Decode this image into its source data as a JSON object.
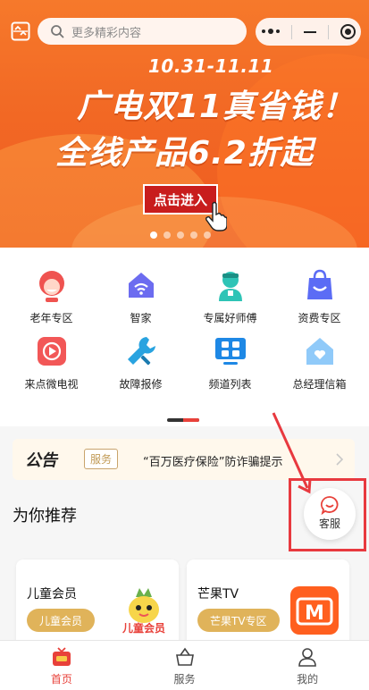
{
  "header": {
    "search_placeholder": "更多精彩内容"
  },
  "banner": {
    "date_range": "10.31-11.11",
    "headline_1": "广电双11真省钱！",
    "headline_2": "全线产品6.2折起",
    "enter_button": "点击进入",
    "slide_count": 5,
    "active_slide": 1
  },
  "services": [
    {
      "label": "老年专区",
      "icon": "elder-icon"
    },
    {
      "label": "智家",
      "icon": "smart-home-icon"
    },
    {
      "label": "专属好师傅",
      "icon": "technician-icon"
    },
    {
      "label": "资费专区",
      "icon": "tariff-bag-icon"
    },
    {
      "label": "来点微电视",
      "icon": "micro-tv-icon"
    },
    {
      "label": "故障报修",
      "icon": "repair-wrench-icon"
    },
    {
      "label": "频道列表",
      "icon": "channel-list-icon"
    },
    {
      "label": "总经理信箱",
      "icon": "manager-mailbox-icon"
    }
  ],
  "notice": {
    "title": "公告",
    "tag": "服务",
    "text": "“百万医疗保险”防诈骗提示"
  },
  "recommend": {
    "title": "为你推荐",
    "cards": [
      {
        "title": "儿童会员",
        "button": "儿童会员",
        "image_text": "儿童会员"
      },
      {
        "title": "芒果TV",
        "button": "芒果TV专区",
        "image_text": "M"
      }
    ]
  },
  "customer_service": {
    "label": "客服"
  },
  "tabbar": {
    "items": [
      {
        "label": "首页",
        "icon": "tv-home-icon",
        "active": true
      },
      {
        "label": "服务",
        "icon": "service-basket-icon",
        "active": false
      },
      {
        "label": "我的",
        "icon": "person-icon",
        "active": false
      }
    ]
  },
  "colors": {
    "accent": "#e8413a",
    "gold": "#e0b35a",
    "banner": "#f26a25"
  }
}
